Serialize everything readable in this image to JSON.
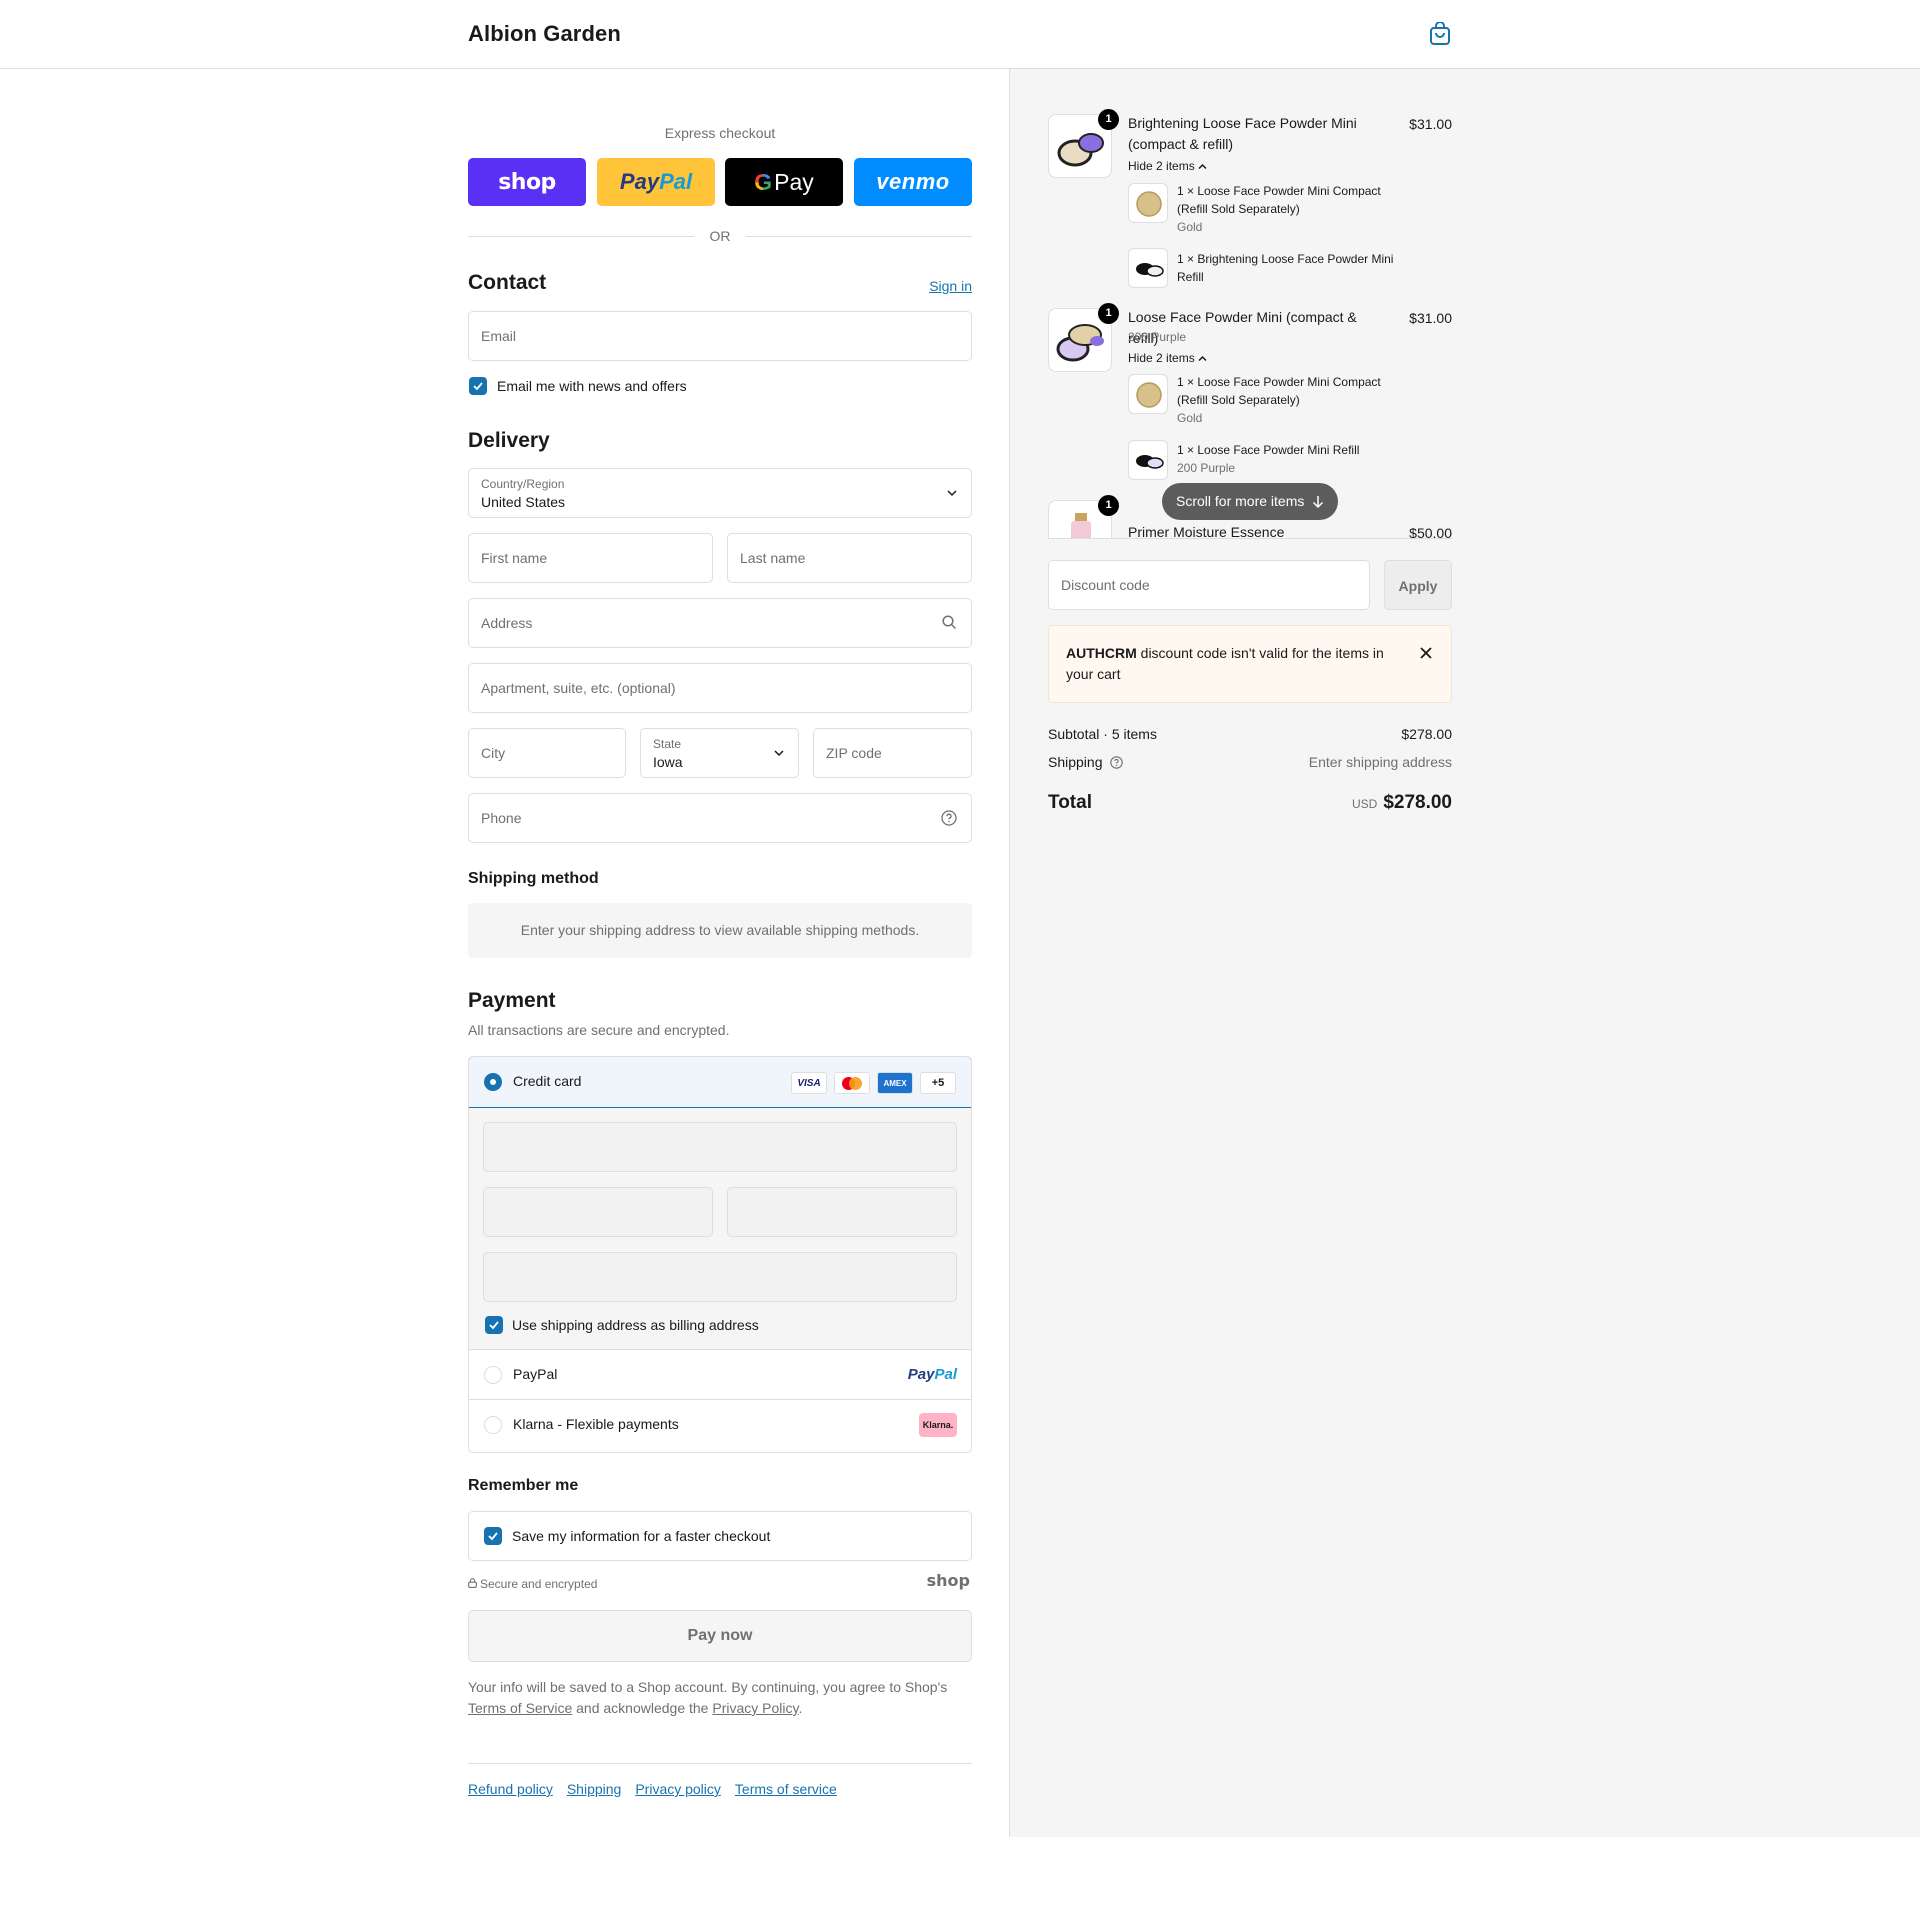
{
  "header": {
    "brand": "Albion Garden",
    "cart_icon": "shopping-bag-icon"
  },
  "express": {
    "title": "Express checkout",
    "buttons": {
      "shop": "shop",
      "paypal_a": "Pay",
      "paypal_b": "Pal",
      "gpay_g": "G",
      "gpay_text": "Pay",
      "venmo": "venmo"
    },
    "or_text": "OR"
  },
  "contact": {
    "title": "Contact",
    "sign_in": "Sign in",
    "email_placeholder": "Email",
    "news_label": "Email me with news and offers"
  },
  "delivery": {
    "title": "Delivery",
    "country_label": "Country/Region",
    "country_value": "United States",
    "first_name": "First name",
    "last_name": "Last name",
    "address": "Address",
    "apartment": "Apartment, suite, etc. (optional)",
    "city": "City",
    "state_label": "State",
    "state_value": "Iowa",
    "zip": "ZIP code",
    "phone": "Phone"
  },
  "shipping_method": {
    "title": "Shipping method",
    "message": "Enter your shipping address to view available shipping methods."
  },
  "payment": {
    "title": "Payment",
    "subtitle": "All transactions are secure and encrypted.",
    "credit_card": "Credit card",
    "card_logos": {
      "visa": "VISA",
      "amex": "AMEX",
      "more": "+5"
    },
    "billing_same": "Use shipping address as billing address",
    "paypal": "PayPal",
    "paypal_logo_a": "Pay",
    "paypal_logo_b": "Pal",
    "klarna": "Klarna - Flexible payments",
    "klarna_logo": "Klarna."
  },
  "remember": {
    "title": "Remember me",
    "save_label": "Save my information for a faster checkout",
    "secure_text": "Secure and encrypted",
    "shop_logo": "shop"
  },
  "pay_now": "Pay now",
  "legal": {
    "part1": "Your info will be saved to a Shop account. By continuing, you agree to Shop's",
    "terms": "Terms of Service",
    "part2": "and acknowledge the",
    "privacy": "Privacy Policy",
    "part3": "."
  },
  "footer": {
    "refund": "Refund policy",
    "shipping": "Shipping",
    "privacy": "Privacy policy",
    "terms": "Terms of service"
  },
  "cart": {
    "items": [
      {
        "qty": "1",
        "name": "Brightening Loose Face Powder Mini (compact & refill)",
        "price": "$31.00",
        "hide": "Hide 2 items",
        "subitems": [
          {
            "name": "1 × Loose Face Powder Mini Compact (Refill Sold Separately)",
            "variant": "Gold"
          },
          {
            "name": "1 × Brightening Loose Face Powder Mini Refill",
            "variant": ""
          }
        ]
      },
      {
        "qty": "1",
        "name": "Loose Face Powder Mini (compact & refill)",
        "variant": "200 Purple",
        "price": "$31.00",
        "hide": "Hide 2 items",
        "subitems": [
          {
            "name": "1 × Loose Face Powder Mini Compact (Refill Sold Separately)",
            "variant": "Gold"
          },
          {
            "name": "1 × Loose Face Powder Mini Refill",
            "variant": "200 Purple"
          }
        ]
      },
      {
        "qty": "1",
        "name": "Primer Moisture Essence",
        "price": "$50.00"
      }
    ],
    "scroll_hint": "Scroll for more items",
    "discount_placeholder": "Discount code",
    "apply": "Apply",
    "alert_code": "AUTHCRM",
    "alert_text": "discount code isn't valid for the items in your cart",
    "subtotal_label": "Subtotal · 5 items",
    "subtotal_value": "$278.00",
    "shipping_label": "Shipping",
    "shipping_value": "Enter shipping address",
    "total_label": "Total",
    "currency": "USD",
    "total_value": "$278.00"
  },
  "colors": {
    "accent": "#1773b0",
    "shop": "#5a31f4",
    "paypal": "#ffc439",
    "venmo": "#008cff",
    "alert_bg": "#fff8f0"
  }
}
